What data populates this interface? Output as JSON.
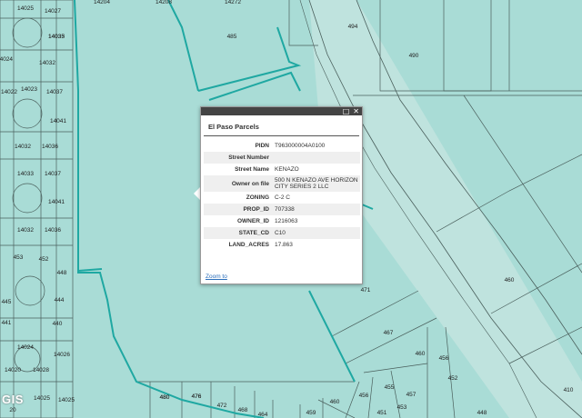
{
  "map": {
    "colors": {
      "land": "#a9dcd6",
      "road": "#bfe3de",
      "line": "#4a5f5c",
      "highlight": "#1fa8a2"
    },
    "parcel_labels": [
      "14025",
      "14027",
      "14033",
      "14032",
      "14024",
      "14022",
      "14023",
      "14037",
      "14041",
      "14036",
      "14032",
      "14033",
      "14041",
      "14032",
      "14036",
      "14037",
      "453",
      "452",
      "448",
      "444",
      "441",
      "440",
      "445",
      "14020",
      "14028",
      "14024",
      "14026",
      "14025",
      "14025",
      "480",
      "476",
      "472",
      "468",
      "464",
      "460",
      "459",
      "456",
      "455",
      "451",
      "453",
      "457",
      "460",
      "456",
      "452",
      "448",
      "471",
      "467",
      "460",
      "410",
      "485",
      "494",
      "490",
      "14272",
      "14204",
      "14208",
      "480",
      "476",
      "14035",
      "20"
    ],
    "attribution": "GIS"
  },
  "popup": {
    "title": "El Paso Parcels",
    "buttons": {
      "maximize": "□",
      "close": "✕"
    },
    "fields": [
      {
        "key": "PIDN",
        "value": "T963000004A0100"
      },
      {
        "key": "Street Number",
        "value": ""
      },
      {
        "key": "Street Name",
        "value": "KENAZO"
      },
      {
        "key": "Owner on file",
        "value": "500 N KENAZO AVE HORIZON CITY SERIES 2 LLC"
      },
      {
        "key": "ZONING",
        "value": "C-2 C"
      },
      {
        "key": "PROP_ID",
        "value": "707338"
      },
      {
        "key": "OWNER_ID",
        "value": "1216063"
      },
      {
        "key": "STATE_CD",
        "value": "C10"
      },
      {
        "key": "LAND_ACRES",
        "value": "17.863"
      }
    ],
    "zoom_link": "Zoom to"
  }
}
